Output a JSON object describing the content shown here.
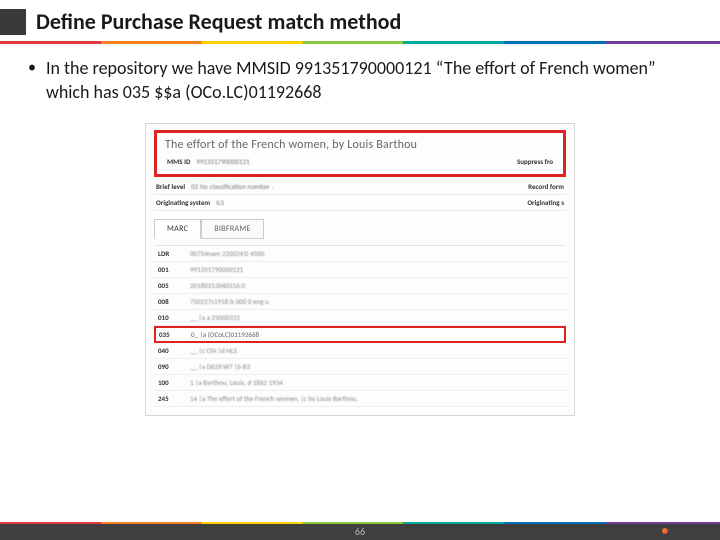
{
  "title": "Define Purchase Request match method",
  "bullet": "In the repository we have MMSID 991351790000121 “The effort of French women” which has 035 $$a (OCo.LC)01192668",
  "record": {
    "title": "The effort of the French women, by Louis Barthou",
    "meta": [
      {
        "label": "MMS ID",
        "value": "991351790000121",
        "label2": "Suppress fro"
      },
      {
        "label": "Brief level",
        "value": "02   No classification number .",
        "label2": "Record form"
      },
      {
        "label": "Originating system",
        "value": "ILS",
        "label2": "Originating s"
      }
    ],
    "tabs": {
      "marc": "MARC",
      "bibframe": "BIBFRAME"
    },
    "marc_rows": [
      {
        "tag": "LDR",
        "val": "00754nam 2200241I 4500"
      },
      {
        "tag": "001",
        "val": "991351790000121"
      },
      {
        "tag": "005",
        "val": "20180313040316.0"
      },
      {
        "tag": "008",
        "val": "750227s1918 ls 000 0 eng u"
      },
      {
        "tag": "010",
        "val": "__ |a a 25000332"
      },
      {
        "tag": "035",
        "val": "0_ |a (OCoLC)01192668",
        "highlight": true
      },
      {
        "tag": "040",
        "val": "__ |c CIN |d HLS"
      },
      {
        "tag": "090",
        "val": "__ |a D639.W7 |b B3"
      },
      {
        "tag": "100",
        "val": "1  |a Barthou, Louis, d 1862 1934"
      },
      {
        "tag": "245",
        "val": "14 |a The effort of the French women, |c by Louis Barthou."
      }
    ]
  },
  "page_number": "66"
}
